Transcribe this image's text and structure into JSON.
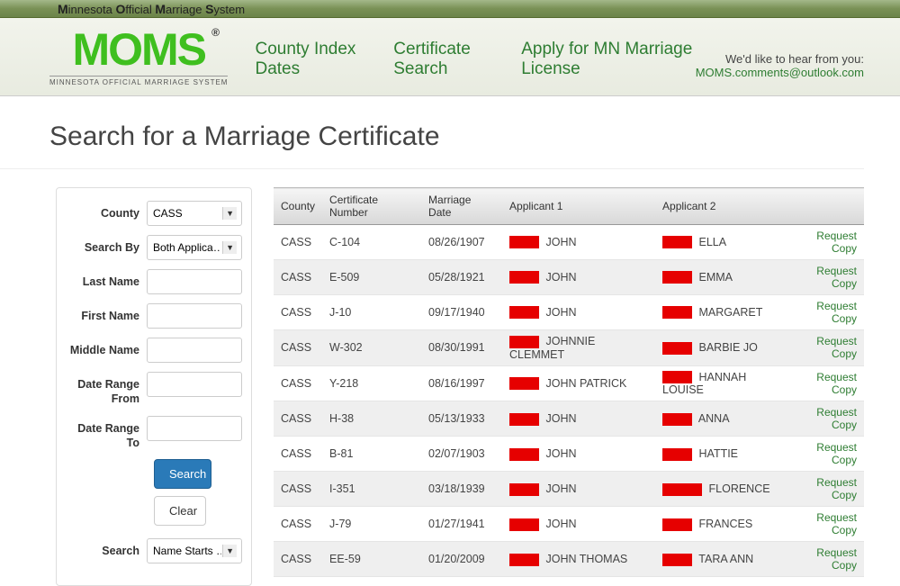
{
  "top_bar": {
    "m1": "M",
    "w1": "innesota ",
    "o1": "O",
    "w2": "fficial ",
    "m2": "M",
    "w3": "arriage ",
    "s1": "S",
    "w4": "ystem"
  },
  "logo": {
    "main": "MOMS",
    "reg": "®",
    "sub": "MINNESOTA OFFICIAL MARRIAGE SYSTEM"
  },
  "nav": {
    "county_index": "County Index Dates",
    "cert_search": "Certificate Search",
    "apply": "Apply for MN Marriage License"
  },
  "contact": {
    "line1": "We'd like to hear from you:",
    "email": "MOMS.comments@outlook.com"
  },
  "page_title": "Search for a Marriage Certificate",
  "form": {
    "county_label": "County",
    "county_value": "CASS",
    "searchby_label": "Search By",
    "searchby_value": "Both Applica…",
    "last_label": "Last Name",
    "first_label": "First Name",
    "middle_label": "Middle Name",
    "from_label": "Date Range From",
    "to_label": "Date Range To",
    "search_btn": "Search",
    "clear_btn": "Clear",
    "search_mode_label": "Search",
    "search_mode_value": "Name Starts …"
  },
  "table": {
    "headers": {
      "county": "County",
      "cert": "Certificate Number",
      "date": "Marriage Date",
      "app1": "Applicant 1",
      "app2": "Applicant 2"
    },
    "request_label": "Request Copy",
    "rows": [
      {
        "county": "CASS",
        "cert": "C-104",
        "date": "08/26/1907",
        "r1w": 33,
        "app1": "JOHN",
        "r2w": 33,
        "app2": "ELLA"
      },
      {
        "county": "CASS",
        "cert": "E-509",
        "date": "05/28/1921",
        "r1w": 33,
        "app1": "JOHN",
        "r2w": 33,
        "app2": "EMMA"
      },
      {
        "county": "CASS",
        "cert": "J-10",
        "date": "09/17/1940",
        "r1w": 33,
        "app1": "JOHN",
        "r2w": 33,
        "app2": "MARGARET"
      },
      {
        "county": "CASS",
        "cert": "W-302",
        "date": "08/30/1991",
        "r1w": 33,
        "app1": "JOHNNIE CLEMMET",
        "r2w": 33,
        "app2": "BARBIE JO"
      },
      {
        "county": "CASS",
        "cert": "Y-218",
        "date": "08/16/1997",
        "r1w": 33,
        "app1": "JOHN PATRICK",
        "r2w": 33,
        "app2": "HANNAH LOUISE"
      },
      {
        "county": "CASS",
        "cert": "H-38",
        "date": "05/13/1933",
        "r1w": 33,
        "app1": "JOHN",
        "r2w": 33,
        "app2": "ANNA"
      },
      {
        "county": "CASS",
        "cert": "B-81",
        "date": "02/07/1903",
        "r1w": 33,
        "app1": "JOHN",
        "r2w": 33,
        "app2": "HATTIE"
      },
      {
        "county": "CASS",
        "cert": "I-351",
        "date": "03/18/1939",
        "r1w": 33,
        "app1": "JOHN",
        "r2w": 44,
        "app2": "FLORENCE"
      },
      {
        "county": "CASS",
        "cert": "J-79",
        "date": "01/27/1941",
        "r1w": 33,
        "app1": "JOHN",
        "r2w": 33,
        "app2": "FRANCES"
      },
      {
        "county": "CASS",
        "cert": "EE-59",
        "date": "01/20/2009",
        "r1w": 33,
        "app1": "JOHN THOMAS",
        "r2w": 33,
        "app2": "TARA ANN"
      }
    ]
  }
}
